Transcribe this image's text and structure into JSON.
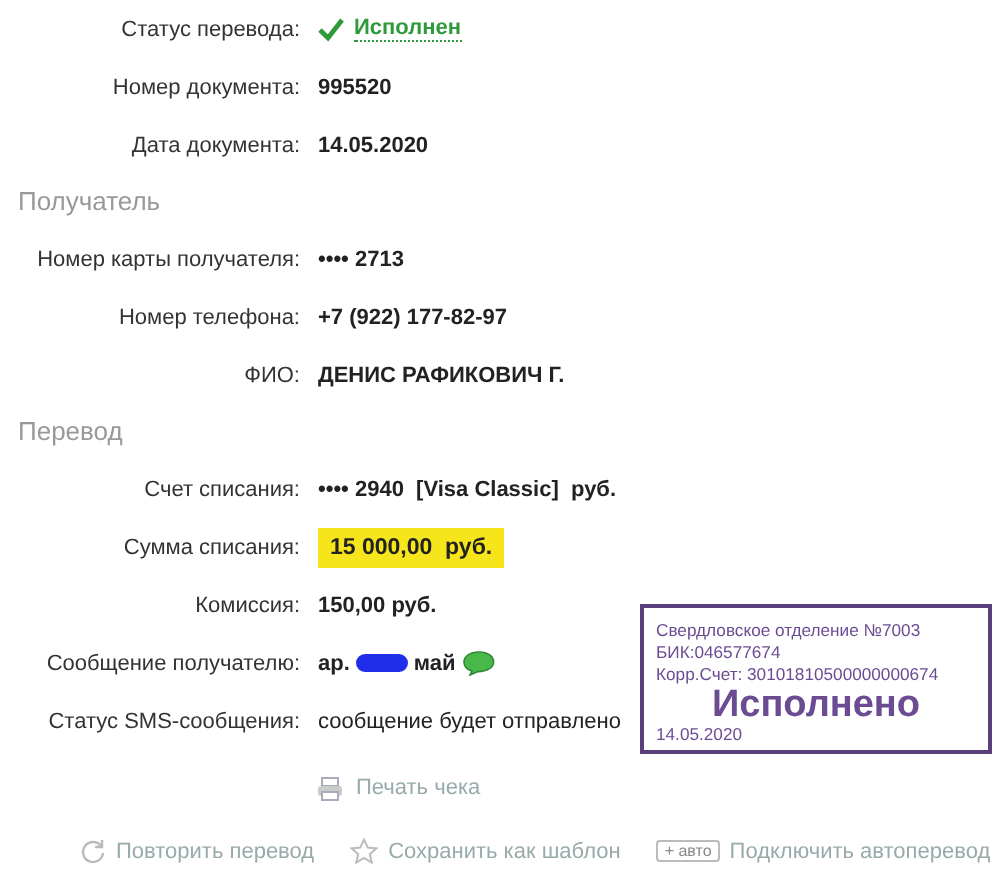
{
  "details": [
    {
      "kind": "status",
      "label": "Статус перевода:",
      "value": "Исполнен"
    },
    {
      "kind": "plain",
      "label": "Номер документа:",
      "value": "995520"
    },
    {
      "kind": "plain",
      "label": "Дата документа:",
      "value": "14.05.2020"
    }
  ],
  "sections": [
    {
      "title": "Получатель",
      "rows": [
        {
          "kind": "plain",
          "label": "Номер карты получателя:",
          "value": "•••• 2713"
        },
        {
          "kind": "plain",
          "label": "Номер телефона:",
          "value": "+7 (922) 177-82-97"
        },
        {
          "kind": "plain",
          "label": "ФИО:",
          "value": "ДЕНИС РАФИКОВИЧ Г."
        }
      ]
    },
    {
      "title": "Перевод",
      "rows": [
        {
          "kind": "plain",
          "label": "Счет списания:",
          "value": "•••• 2940  [Visa Classic]  руб."
        },
        {
          "kind": "highlight",
          "label": "Сумма списания:",
          "value": "15 000,00  руб."
        },
        {
          "kind": "plain",
          "label": "Комиссия:",
          "value": "150,00 руб."
        },
        {
          "kind": "message",
          "label": "Сообщение получателю:",
          "value": "ар.",
          "value_end": "май"
        },
        {
          "kind": "light",
          "label": "Статус SMS-сообщения:",
          "value": "сообщение будет отправлено"
        }
      ]
    }
  ],
  "print_link": "Печать чека",
  "actions": [
    {
      "kind": "repeat",
      "label": "Повторить перевод"
    },
    {
      "kind": "star",
      "label": "Сохранить как шаблон"
    },
    {
      "kind": "auto",
      "badge": "+ авто",
      "label": "Подключить автоперевод"
    }
  ],
  "stamp": {
    "lines": [
      "Свердловское отделение №7003",
      "БИК:046577674",
      "Корр.Счет: 30101810500000000674"
    ],
    "status": "Исполнено",
    "date": "14.05.2020"
  }
}
